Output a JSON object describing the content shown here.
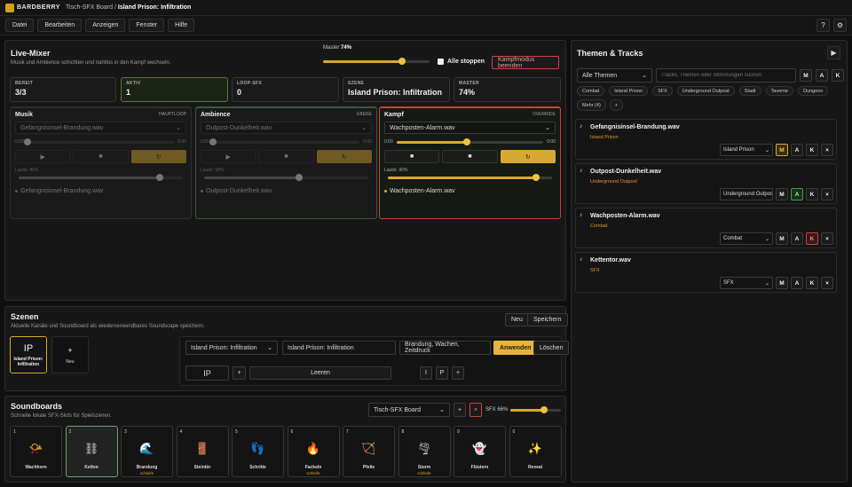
{
  "app": {
    "brand": "BARDBERRY",
    "board": "Tisch-SFX Board",
    "separator": "/",
    "scene": "Island Prison: Infiltration"
  },
  "menu": [
    "Datei",
    "Bearbeiten",
    "Anzeigen",
    "Fenster",
    "Hilfe"
  ],
  "toolbar_right": {
    "help": "?",
    "settings_icon": "gear-icon"
  },
  "mixer": {
    "title": "Live-Mixer",
    "subtitle": "Musik und Ambience schichten und nahtlos in den Kampf wechseln.",
    "master_label": "Master",
    "master_value": "74%",
    "master_level": 0.74,
    "stop_all": "Alle stoppen",
    "end_combat": "Kampfmodus beenden",
    "stats": [
      {
        "label": "BEREIT",
        "value": "3/3"
      },
      {
        "label": "AKTIV",
        "value": "1"
      },
      {
        "label": "LOOP-SFX",
        "value": "0"
      },
      {
        "label": "SZENE",
        "value": "Island Prison: Infiltration"
      },
      {
        "label": "MASTER",
        "value": "74%"
      }
    ],
    "decks": [
      {
        "name": "Musik",
        "tag": "HAUPTLOOP",
        "file": "Gefangnisinsel-Brandung.wav",
        "time_start": "0:00",
        "time_end": "0:00",
        "volume_label": "Lautst. 86%",
        "volume": 0.86,
        "progress": 0,
        "footer": "Gefangnisinsel-Brandung.wav",
        "play": "▶",
        "stop": "■",
        "loop": "↻"
      },
      {
        "name": "Ambience",
        "tag": "EBENE",
        "file": "Outpost-Dunkelheit.wav",
        "time_start": "0:00",
        "time_end": "0:00",
        "volume_label": "Lautst. 58%",
        "volume": 0.58,
        "progress": 0,
        "footer": "Outpost-Dunkelheit.wav",
        "play": "▶",
        "stop": "■",
        "loop": "↻"
      },
      {
        "name": "Kampf",
        "tag": "OVERRIDE",
        "file": "Wachposten-Alarm.wav",
        "time_start": "0:00",
        "time_end": "0:00",
        "volume_label": "Lautst. 90%",
        "volume": 0.9,
        "progress": 0.48,
        "footer": "Wachposten-Alarm.wav",
        "play": "■",
        "stop": "■",
        "loop": "↻"
      }
    ]
  },
  "scenes": {
    "title": "Szenen",
    "subtitle": "Aktuelle Kanäle und Soundboard als wiederverwendbares Soundscape speichern.",
    "new": "Neu",
    "save": "Speichern",
    "card": {
      "initials": "IP",
      "label": "Island Prison: Infiltration"
    },
    "add_card": {
      "icon": "+",
      "label": "Neu"
    },
    "select": "Island Prison: Infiltration",
    "name_value": "Island Prison: Infiltration",
    "tags_value": "Brandung, Wachen, Zeitdruck",
    "apply": "Anwenden",
    "delete": "Löschen",
    "initials_value": "IP",
    "plus": "+",
    "clear": "Leeren",
    "btn_i": "I",
    "btn_p": "P",
    "plus2": "+"
  },
  "soundboards": {
    "title": "Soundboards",
    "subtitle": "Schnelle lokale SFX-Slots für Spielszenen.",
    "board_select": "Tisch-SFX Board",
    "add": "+",
    "remove": "×",
    "sfx_label": "SFX 66%",
    "sfx_level": 0.66,
    "slots": [
      {
        "num": "1",
        "label": "Wachhorn",
        "loop": "",
        "icon": "horn-icon",
        "glyph": "📯",
        "active": false
      },
      {
        "num": "2",
        "label": "Ketten",
        "loop": "",
        "icon": "chain-icon",
        "glyph": "⛓",
        "active": true
      },
      {
        "num": "3",
        "label": "Brandung",
        "loop": "schleife",
        "icon": "wave-icon",
        "glyph": "🌊",
        "active": false
      },
      {
        "num": "4",
        "label": "Steintür",
        "loop": "",
        "icon": "door-icon",
        "glyph": "🚪",
        "active": false
      },
      {
        "num": "5",
        "label": "Schritte",
        "loop": "",
        "icon": "footsteps-icon",
        "glyph": "👣",
        "active": false
      },
      {
        "num": "6",
        "label": "Fackeln",
        "loop": "schleife",
        "icon": "torch-icon",
        "glyph": "🔥",
        "active": false
      },
      {
        "num": "7",
        "label": "Pfeile",
        "loop": "",
        "icon": "bow-icon",
        "glyph": "🏹",
        "active": false
      },
      {
        "num": "8",
        "label": "Sturm",
        "loop": "schleife",
        "icon": "storm-icon",
        "glyph": "🌪",
        "active": false
      },
      {
        "num": "9",
        "label": "Flüstern",
        "loop": "",
        "icon": "whisper-icon",
        "glyph": "👻",
        "active": false
      },
      {
        "num": "0",
        "label": "Reveal",
        "loop": "",
        "icon": "sparkle-icon",
        "glyph": "✨",
        "active": false
      }
    ]
  },
  "themes": {
    "title": "Themen & Tracks",
    "play": "▶",
    "filter_select": "Alle Themen",
    "search_placeholder": "Tracks, Themen oder Stimmungen suchen",
    "mode_buttons": [
      "M",
      "A",
      "K"
    ],
    "chips": [
      "Combat",
      "Island Prison",
      "SFX",
      "Underground Outpost",
      "Stadt",
      "Taverne",
      "Dungeon",
      "Mystisch"
    ],
    "more": "Mehr (4)",
    "more_plus": "+",
    "tracks": [
      {
        "title": "Gefangnisinsel-Brandung.wav",
        "category": "Island Prison",
        "select": "Island Prison",
        "active": "M"
      },
      {
        "title": "Outpost-Dunkelheit.wav",
        "category": "Underground Outpost",
        "select": "Underground Outpost",
        "active": "A"
      },
      {
        "title": "Wachposten-Alarm.wav",
        "category": "Combat",
        "select": "Combat",
        "active": "K"
      },
      {
        "title": "Kettentor.wav",
        "category": "SFX",
        "select": "SFX",
        "active": ""
      }
    ]
  }
}
